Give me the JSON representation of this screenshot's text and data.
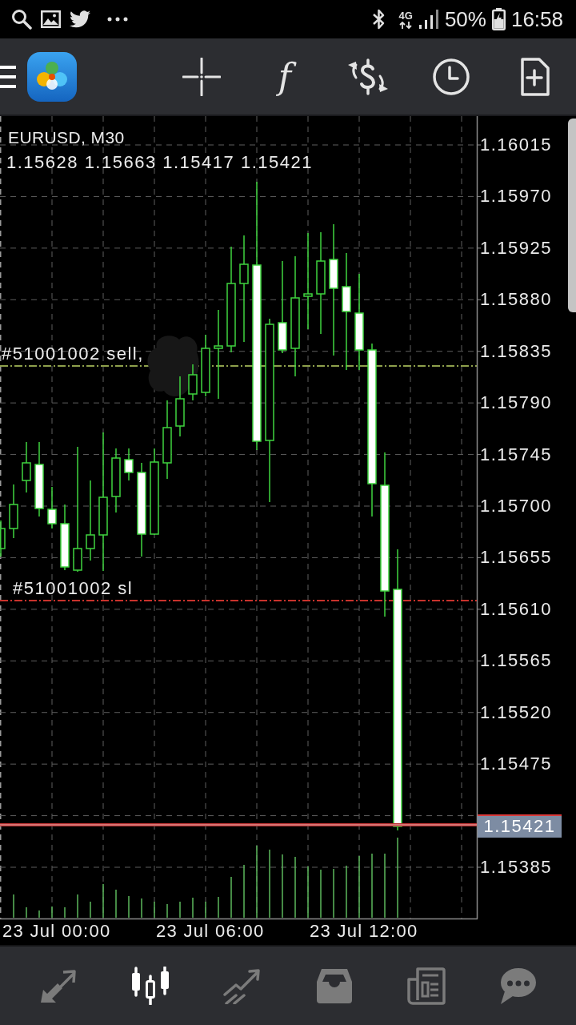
{
  "status_bar": {
    "network": "4G",
    "battery": "50%",
    "time": "16:58"
  },
  "toolbar": {
    "function_button": "f"
  },
  "chart": {
    "title": "EURUSD, M30",
    "ohlc": "1.15628 1.15663 1.15417 1.15421",
    "order_lines": [
      {
        "kind": "sell",
        "label": "#51001002 sell,"
      },
      {
        "kind": "stop_loss",
        "label": "#51001002 sl"
      }
    ],
    "price_axis": [
      "1.16015",
      "1.15970",
      "1.15925",
      "1.15880",
      "1.15835",
      "1.15790",
      "1.15745",
      "1.15700",
      "1.15655",
      "1.15610",
      "1.15565",
      "1.15520",
      "1.15475",
      "1.15385"
    ],
    "current_price": "1.15421",
    "time_axis": [
      "23 Jul 00:00",
      "23 Jul 06:00",
      "23 Jul 12:00"
    ]
  },
  "bottom_nav": [
    {
      "kind": "quotes",
      "selected": false
    },
    {
      "kind": "chart",
      "selected": true
    },
    {
      "kind": "trade",
      "selected": false
    },
    {
      "kind": "history",
      "selected": false
    },
    {
      "kind": "news",
      "selected": false
    },
    {
      "kind": "chat",
      "selected": false
    }
  ]
}
